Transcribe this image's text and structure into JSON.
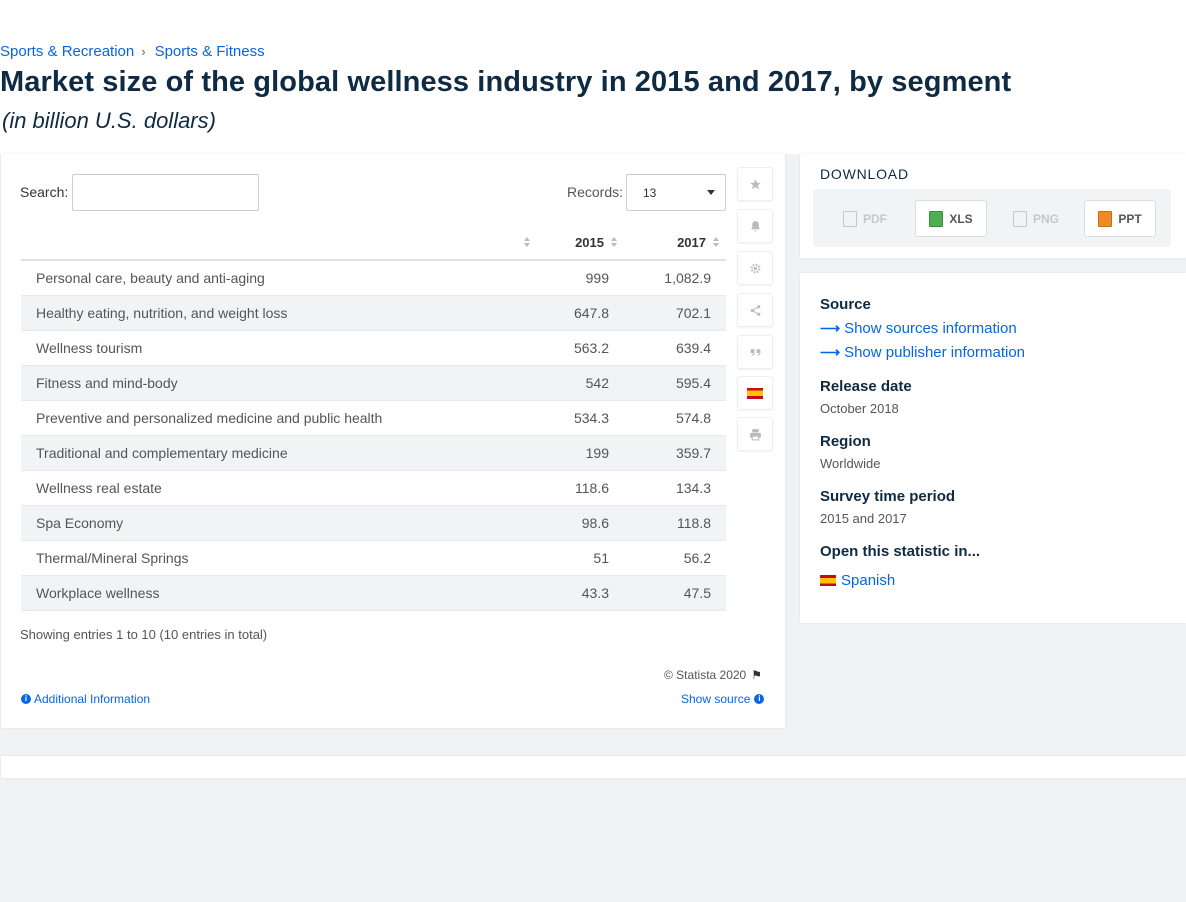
{
  "breadcrumb": [
    "Sports & Recreation",
    "Sports & Fitness"
  ],
  "title": "Market size of the global wellness industry in 2015 and 2017, by segment",
  "subtitle": "(in billion U.S. dollars)",
  "controls": {
    "search_label": "Search:",
    "search_value": "",
    "records_label": "Records:",
    "records_value": "13"
  },
  "table": {
    "columns": [
      "",
      "2015",
      "2017"
    ],
    "rows": [
      {
        "label": "Personal care, beauty and anti-aging",
        "v2015": "999",
        "v2017": "1,082.9"
      },
      {
        "label": "Healthy eating, nutrition, and weight loss",
        "v2015": "647.8",
        "v2017": "702.1"
      },
      {
        "label": "Wellness tourism",
        "v2015": "563.2",
        "v2017": "639.4"
      },
      {
        "label": "Fitness and mind-body",
        "v2015": "542",
        "v2017": "595.4"
      },
      {
        "label": "Preventive and personalized medicine and public health",
        "v2015": "534.3",
        "v2017": "574.8"
      },
      {
        "label": "Traditional and complementary medicine",
        "v2015": "199",
        "v2017": "359.7"
      },
      {
        "label": "Wellness real estate",
        "v2015": "118.6",
        "v2017": "134.3"
      },
      {
        "label": "Spa Economy",
        "v2015": "98.6",
        "v2017": "118.8"
      },
      {
        "label": "Thermal/Mineral Springs",
        "v2015": "51",
        "v2017": "56.2"
      },
      {
        "label": "Workplace wellness",
        "v2015": "43.3",
        "v2017": "47.5"
      }
    ]
  },
  "chart_data": {
    "type": "table",
    "title": "Market size of the global wellness industry in 2015 and 2017, by segment",
    "subtitle": "(in billion U.S. dollars)",
    "categories": [
      "Personal care, beauty and anti-aging",
      "Healthy eating, nutrition, and weight loss",
      "Wellness tourism",
      "Fitness and mind-body",
      "Preventive and personalized medicine and public health",
      "Traditional and complementary medicine",
      "Wellness real estate",
      "Spa Economy",
      "Thermal/Mineral Springs",
      "Workplace wellness"
    ],
    "series": [
      {
        "name": "2015",
        "values": [
          999,
          647.8,
          563.2,
          542,
          534.3,
          199,
          118.6,
          98.6,
          51,
          43.3
        ]
      },
      {
        "name": "2017",
        "values": [
          1082.9,
          702.1,
          639.4,
          595.4,
          574.8,
          359.7,
          134.3,
          118.8,
          56.2,
          47.5
        ]
      }
    ]
  },
  "footer": {
    "entries": "Showing entries 1 to 10 (10 entries in total)",
    "copyright": "© Statista 2020",
    "additional_info": "Additional Information",
    "show_source": "Show source"
  },
  "toolbar_icons": [
    "star-icon",
    "bell-icon",
    "gear-icon",
    "share-icon",
    "quote-icon",
    "spanish-flag-icon",
    "print-icon"
  ],
  "download": {
    "title": "DOWNLOAD",
    "pdf": "PDF",
    "xls": "XLS",
    "png": "PNG",
    "ppt": "PPT"
  },
  "meta": {
    "source_h": "Source",
    "show_sources": "Show sources information",
    "show_publisher": "Show publisher information",
    "release_h": "Release date",
    "release_v": "October 2018",
    "region_h": "Region",
    "region_v": "Worldwide",
    "survey_h": "Survey time period",
    "survey_v": "2015 and 2017",
    "open_h": "Open this statistic in...",
    "spanish": "Spanish"
  },
  "colors": {
    "accent": "#0666e5",
    "title": "#0f2a43",
    "row_alt": "#f2f3f5"
  }
}
